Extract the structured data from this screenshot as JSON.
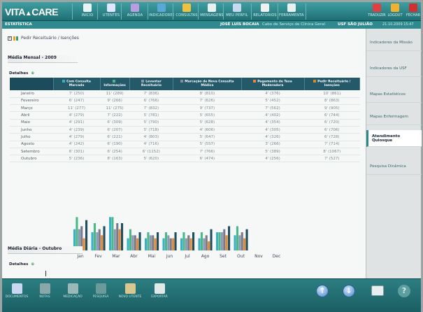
{
  "app": {
    "logo": "VITA",
    "logo_sub": "CARE"
  },
  "toolbar": {
    "items": [
      {
        "label": "INÍCIO",
        "color": "#e8f4f4"
      },
      {
        "label": "UTENTES",
        "color": "#e0e6ff"
      },
      {
        "label": "AGENDA",
        "color": "#b89de0"
      },
      {
        "label": "INDICADORES",
        "color": "#5aa8d8"
      },
      {
        "label": "CONSULTAS",
        "color": "#f0c040"
      },
      {
        "label": "MENSAGENS",
        "color": "#e8f0f0"
      },
      {
        "label": "MEU PERFIL",
        "color": "#c8d8f0"
      },
      {
        "label": "RELATÓRIOS",
        "color": "#f0f0f0"
      },
      {
        "label": "FERRAMENTAS",
        "color": "#e8f0f0"
      }
    ],
    "right": [
      {
        "label": "TRADUZIR",
        "color": "#e04040"
      },
      {
        "label": "LOGOUT",
        "color": "#f0b030"
      },
      {
        "label": "FECHAR",
        "color": "#d03030"
      }
    ]
  },
  "header": {
    "section": "ESTATÍSTICA",
    "user": "JOSÉ LUÍS BOCAIA",
    "user_role": "Cabo de Serviço de Clínica Geral",
    "unit": "USF SÃO JULIÃO",
    "datetime": "21.10.2009 15:47"
  },
  "breadcrumb": "Pedir Receituário / Isenções",
  "section_monthly": "Média Mensal - 2009",
  "section_daily": "Média Diária - Outubro",
  "details_label": "Detalhes",
  "table": {
    "headers": [
      {
        "label": "",
        "color": ""
      },
      {
        "label": "Com Consulta Marcada",
        "color": "#3ab0c8"
      },
      {
        "label": "Informações",
        "color": "#4cb88a"
      },
      {
        "label": "Levantar Receituário",
        "color": "#8a9ab0"
      },
      {
        "label": "Marcação de Nova Consulta Médica",
        "color": "#8a8a9a"
      },
      {
        "label": "Pagamento de Taxa Moderadora",
        "color": "#e08a3a"
      },
      {
        "label": "Pedir Receituário / Isenções",
        "color": "#d88a2a"
      }
    ],
    "rows": [
      [
        "Janeiro",
        "7' (250)",
        "11' (289)",
        "7' (836)",
        "8' (810)",
        "4' (376)",
        "10' (861)"
      ],
      [
        "Fevereiro",
        "6' (247)",
        "9' (266)",
        "6' (766)",
        "7' (626)",
        "5' (452)",
        "8' (863)"
      ],
      [
        "Março",
        "11' (277)",
        "11' (275)",
        "7' (832)",
        "9' (737)",
        "7' (562)",
        "9' (905)"
      ],
      [
        "Abril",
        "4' (279)",
        "7' (222)",
        "5' (781)",
        "5' (655)",
        "4' (402)",
        "6' (744)"
      ],
      [
        "Maio",
        "4' (291)",
        "6' (309)",
        "5' (790)",
        "5' (628)",
        "4' (354)",
        "6' (720)"
      ],
      [
        "Junho",
        "4' (239)",
        "6' (207)",
        "5' (718)",
        "4' (606)",
        "4' (305)",
        "6' (706)"
      ],
      [
        "Julho",
        "4' (279)",
        "6' (221)",
        "4' (803)",
        "5' (647)",
        "4' (326)",
        "6' (728)"
      ],
      [
        "Agosto",
        "4' (242)",
        "6' (190)",
        "4' (716)",
        "5' (557)",
        "3' (266)",
        "7' (714)"
      ],
      [
        "Setembro",
        "6' (301)",
        "6' (254)",
        "6' (1152)",
        "7' (766)",
        "5' (389)",
        "8' (1067)"
      ],
      [
        "Outubro",
        "5' (236)",
        "8' (163)",
        "5' (620)",
        "6' (474)",
        "4' (256)",
        "7' (527)"
      ]
    ]
  },
  "chart_data": {
    "type": "bar",
    "categories": [
      "Jan",
      "Fev",
      "Mar",
      "Abr",
      "Mai",
      "Jun",
      "Jul",
      "Ago",
      "Set",
      "Out",
      "Nov",
      "Dec"
    ],
    "series": [
      {
        "name": "Com Consulta Marcada",
        "color": "#3ab0c8",
        "values": [
          7,
          6,
          11,
          4,
          4,
          4,
          4,
          4,
          6,
          5,
          null,
          null
        ]
      },
      {
        "name": "Informações",
        "color": "#4cb88a",
        "values": [
          11,
          9,
          11,
          7,
          6,
          6,
          6,
          6,
          6,
          8,
          null,
          null
        ]
      },
      {
        "name": "Levantar Receituário",
        "color": "#8a9ab0",
        "values": [
          7,
          6,
          7,
          5,
          5,
          5,
          4,
          4,
          6,
          5,
          null,
          null
        ]
      },
      {
        "name": "Marcação de Nova Consulta Médica",
        "color": "#7a7a8a",
        "values": [
          8,
          7,
          9,
          5,
          5,
          4,
          5,
          5,
          7,
          6,
          null,
          null
        ]
      },
      {
        "name": "Pagamento de Taxa Moderadora",
        "color": "#e08a3a",
        "values": [
          4,
          5,
          7,
          4,
          4,
          4,
          4,
          3,
          5,
          4,
          null,
          null
        ]
      },
      {
        "name": "Pedir Receituário / Isenções",
        "color": "#1f4f5f",
        "values": [
          10,
          8,
          9,
          6,
          6,
          6,
          6,
          7,
          8,
          7,
          null,
          null
        ]
      }
    ],
    "ylim": [
      0,
      12
    ]
  },
  "right_panel": {
    "items": [
      {
        "label": "Indicadores da Missão",
        "active": false
      },
      {
        "label": "Indicadores da USF",
        "active": false
      },
      {
        "label": "Mapas Estatísticos",
        "active": false
      },
      {
        "label": "Mapas Enfermagem",
        "active": false
      },
      {
        "label": "Atendimento Quiosque",
        "active": true
      },
      {
        "label": "Pesquisa Dinâmica",
        "active": false
      }
    ]
  },
  "bottom": {
    "items": [
      {
        "label": "DOCUMENTOS",
        "color": "#c8d8f0"
      },
      {
        "label": "NOTAS",
        "color": "#8aa8a8"
      },
      {
        "label": "MEDICAÇÃO",
        "color": "#9ab8b8"
      },
      {
        "label": "PESQUISA",
        "color": "#6a9a9a"
      },
      {
        "label": "NOVO UTENTE",
        "color": "#d8c890"
      },
      {
        "label": "EXPORTAR",
        "color": "#e0e8e8"
      }
    ]
  }
}
